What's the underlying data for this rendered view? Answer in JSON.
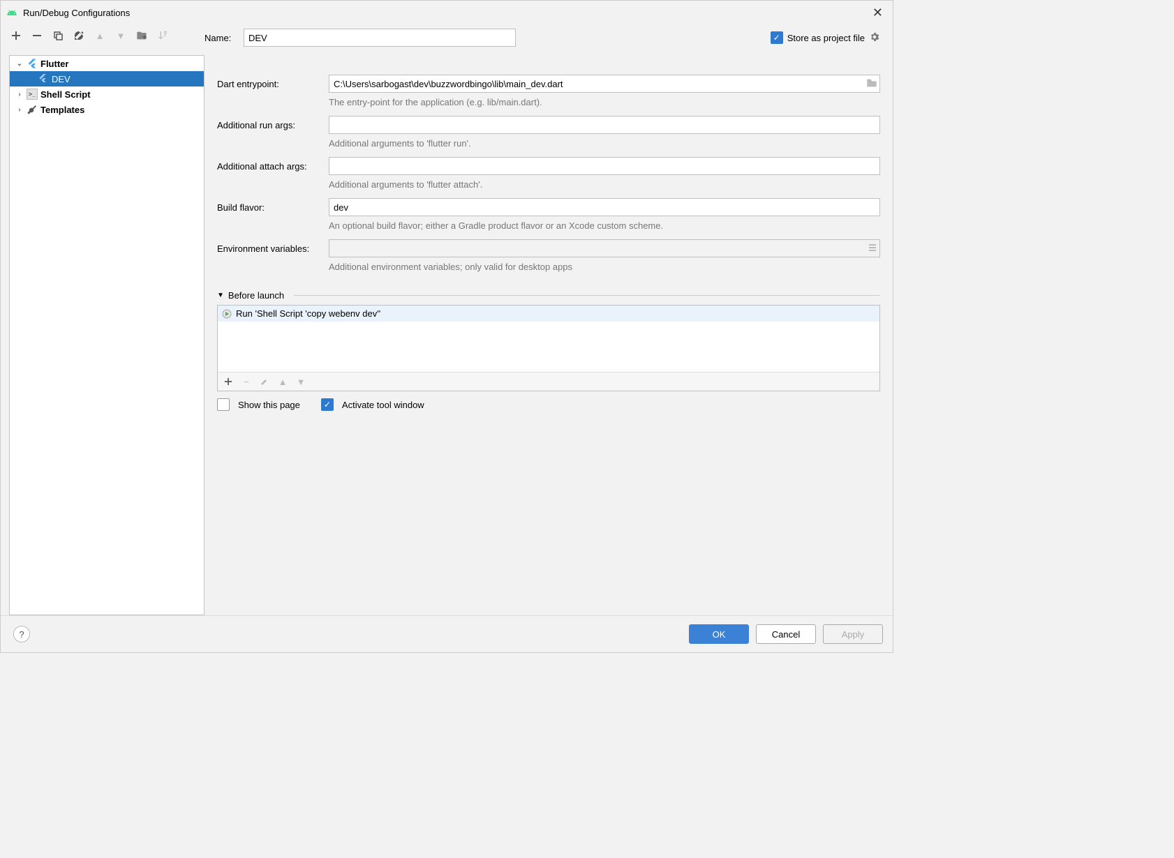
{
  "window": {
    "title": "Run/Debug Configurations"
  },
  "sidebar": {
    "items": [
      {
        "label": "Flutter",
        "expanded": true
      },
      {
        "label": "DEV",
        "selected": true
      },
      {
        "label": "Shell Script"
      },
      {
        "label": "Templates"
      }
    ]
  },
  "form": {
    "name_label": "Name:",
    "name_value": "DEV",
    "store_as_project_file_label": "Store as project file",
    "store_as_project_file_checked": true,
    "dart_entry_label": "Dart entrypoint:",
    "dart_entry_value": "C:\\Users\\sarbogast\\dev\\buzzwordbingo\\lib\\main_dev.dart",
    "dart_entry_hint": "The entry-point for the application (e.g. lib/main.dart).",
    "run_args_label": "Additional run args:",
    "run_args_value": "",
    "run_args_hint": "Additional arguments to 'flutter run'.",
    "attach_args_label": "Additional attach args:",
    "attach_args_value": "",
    "attach_args_hint": "Additional arguments to 'flutter attach'.",
    "build_flavor_label": "Build flavor:",
    "build_flavor_value": "dev",
    "build_flavor_hint": "An optional build flavor; either a Gradle product flavor or an Xcode custom scheme.",
    "env_label": "Environment variables:",
    "env_value": "",
    "env_hint": "Additional environment variables; only valid for desktop apps",
    "before_launch_label": "Before launch",
    "before_launch_item": "Run 'Shell Script 'copy webenv dev''",
    "show_this_page_label": "Show this page",
    "show_this_page_checked": false,
    "activate_tool_window_label": "Activate tool window",
    "activate_tool_window_checked": true
  },
  "footer": {
    "ok": "OK",
    "cancel": "Cancel",
    "apply": "Apply"
  }
}
